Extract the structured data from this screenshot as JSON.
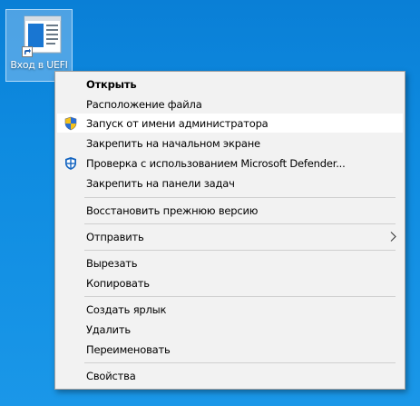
{
  "desktop_icon": {
    "label": "Вход в UEFI"
  },
  "colors": {
    "desktop": "#0e8be0",
    "menu_bg": "#f2f2f2",
    "hover": "#ffffff",
    "separator": "#cfcfcf"
  },
  "menu": {
    "open": "Открыть",
    "file_location": "Расположение файла",
    "run_as_admin": "Запуск от имени администратора",
    "pin_start": "Закрепить на начальном экране",
    "defender_scan": "Проверка с использованием Microsoft Defender...",
    "pin_taskbar": "Закрепить на панели задач",
    "restore_previous": "Восстановить прежнюю версию",
    "send_to": "Отправить",
    "cut": "Вырезать",
    "copy": "Копировать",
    "create_shortcut": "Создать ярлык",
    "delete": "Удалить",
    "rename": "Переименовать",
    "properties": "Свойства"
  },
  "icons": {
    "admin": "uac-shield-icon",
    "defender": "defender-shield-icon",
    "submenu": "chevron-right-icon"
  }
}
